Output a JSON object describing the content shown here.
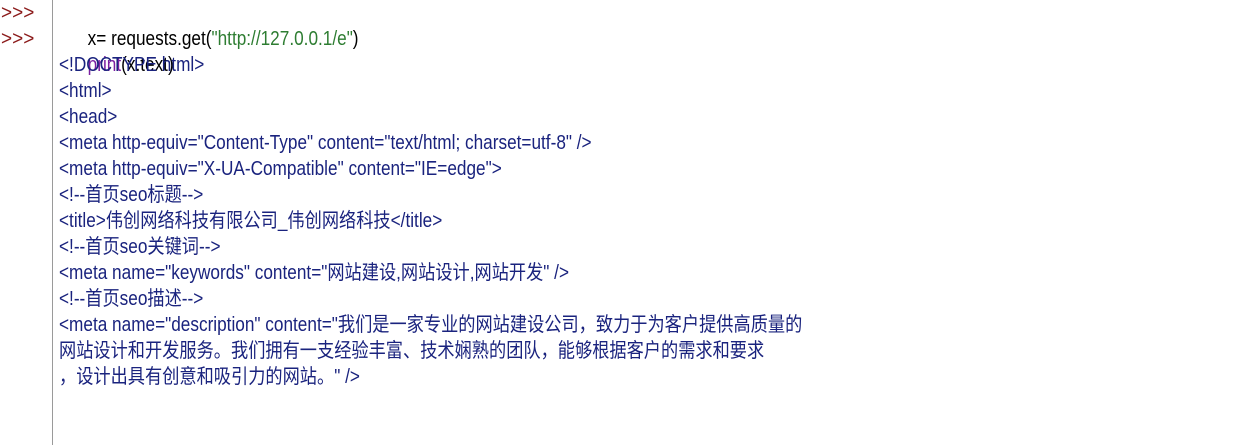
{
  "shell": {
    "prompts": [
      ">>>",
      ">>>"
    ],
    "input_lines": [
      {
        "prefix": "x= requests.get(",
        "string": "\"http://127.0.0.1/e\"",
        "suffix": ")"
      },
      {
        "func": "print",
        "args": "(x.text)"
      }
    ],
    "output_lines": [
      "<!DOCTYPE html>",
      "<html>",
      "<head>",
      "<meta http-equiv=\"Content-Type\" content=\"text/html; charset=utf-8\" />",
      "<meta http-equiv=\"X-UA-Compatible\" content=\"IE=edge\">",
      "<!--首页seo标题-->",
      "<title>伟创网络科技有限公司_伟创网络科技</title>",
      "<!--首页seo关键词-->",
      "<meta name=\"keywords\" content=\"网站建设,网站设计,网站开发\" />",
      "<!--首页seo描述-->",
      "<meta name=\"description\" content=\"我们是一家专业的网站建设公司，致力于为客户提供高质量的",
      "网站设计和开发服务。我们拥有一支经验丰富、技术娴熟的团队，能够根据客户的需求和要求",
      "，设计出具有创意和吸引力的网站。\" />"
    ]
  }
}
